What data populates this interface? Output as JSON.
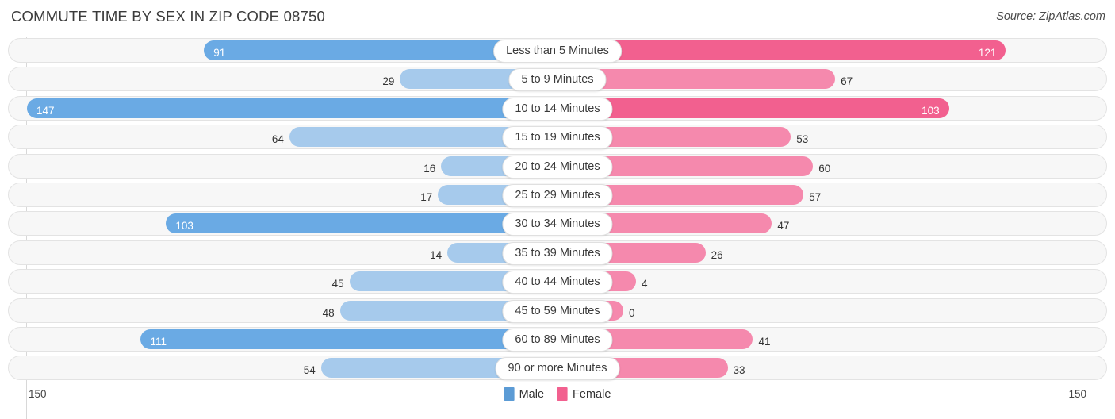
{
  "header": {
    "title": "COMMUTE TIME BY SEX IN ZIP CODE 08750",
    "source": "Source: ZipAtlas.com"
  },
  "footer": {
    "axis_left": "150",
    "axis_right": "150"
  },
  "legend": {
    "items": [
      {
        "label": "Male",
        "color": "#5b9bd5"
      },
      {
        "label": "Female",
        "color": "#f2608f"
      }
    ]
  },
  "chart_data": {
    "type": "bar",
    "orientation": "horizontal-diverging",
    "title": "COMMUTE TIME BY SEX IN ZIP CODE 08750",
    "xlabel": "",
    "ylabel": "",
    "axis_max": 150,
    "xlim": [
      -150,
      150
    ],
    "grid": false,
    "legend_position": "bottom-center",
    "categories": [
      "Less than 5 Minutes",
      "5 to 9 Minutes",
      "10 to 14 Minutes",
      "15 to 19 Minutes",
      "20 to 24 Minutes",
      "25 to 29 Minutes",
      "30 to 34 Minutes",
      "35 to 39 Minutes",
      "40 to 44 Minutes",
      "45 to 59 Minutes",
      "60 to 89 Minutes",
      "90 or more Minutes"
    ],
    "series": [
      {
        "name": "Male",
        "side": "left",
        "values": [
          91,
          29,
          147,
          64,
          16,
          17,
          103,
          14,
          45,
          48,
          111,
          54
        ],
        "labels": [
          "91",
          "29",
          "147",
          "64",
          "16",
          "17",
          "103",
          "14",
          "45",
          "48",
          "111",
          "54"
        ]
      },
      {
        "name": "Female",
        "side": "right",
        "values": [
          121,
          67,
          103,
          53,
          60,
          57,
          47,
          26,
          4,
          0,
          41,
          33
        ],
        "labels": [
          "121",
          "67",
          "103",
          "53",
          "60",
          "57",
          "47",
          "26",
          "4",
          "0",
          "41",
          "33"
        ]
      }
    ]
  }
}
